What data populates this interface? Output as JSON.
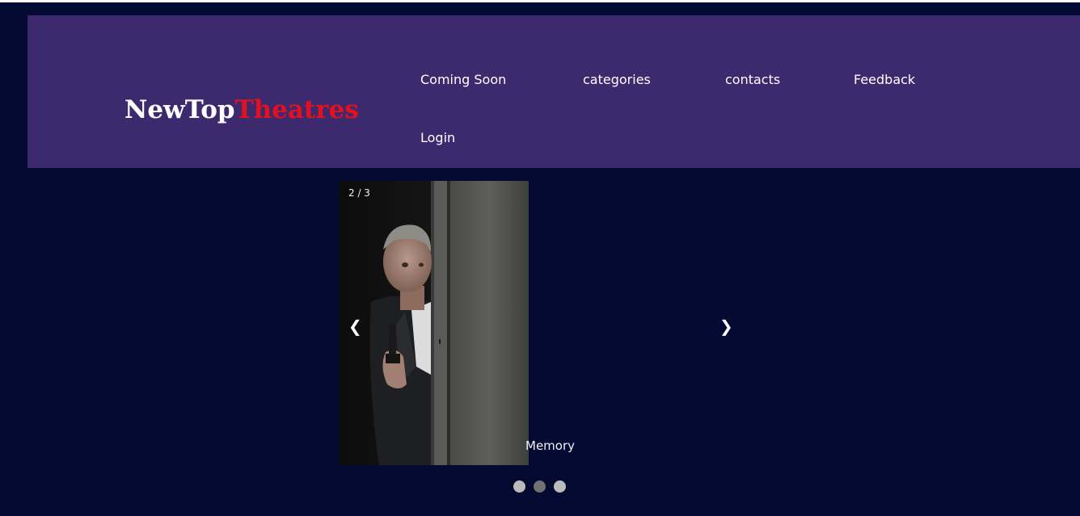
{
  "brand": {
    "part1": "NewTop",
    "part2": "Theatres",
    "part1_color": "#ffffff",
    "part2_color": "#e5101e"
  },
  "nav": {
    "items": [
      {
        "label": "Coming Soon"
      },
      {
        "label": "categories"
      },
      {
        "label": "contacts"
      },
      {
        "label": "Feedback"
      },
      {
        "label": "Login"
      }
    ]
  },
  "slideshow": {
    "number_text": "2 / 3",
    "caption": "Memory",
    "prev_symbol": "❮",
    "next_symbol": "❯",
    "active_dot": 2,
    "dot_count": 3
  },
  "colors": {
    "background": "#030a31",
    "header": "#3d2a6e",
    "dot": "#bbbbbb",
    "dot_active": "#717171"
  }
}
